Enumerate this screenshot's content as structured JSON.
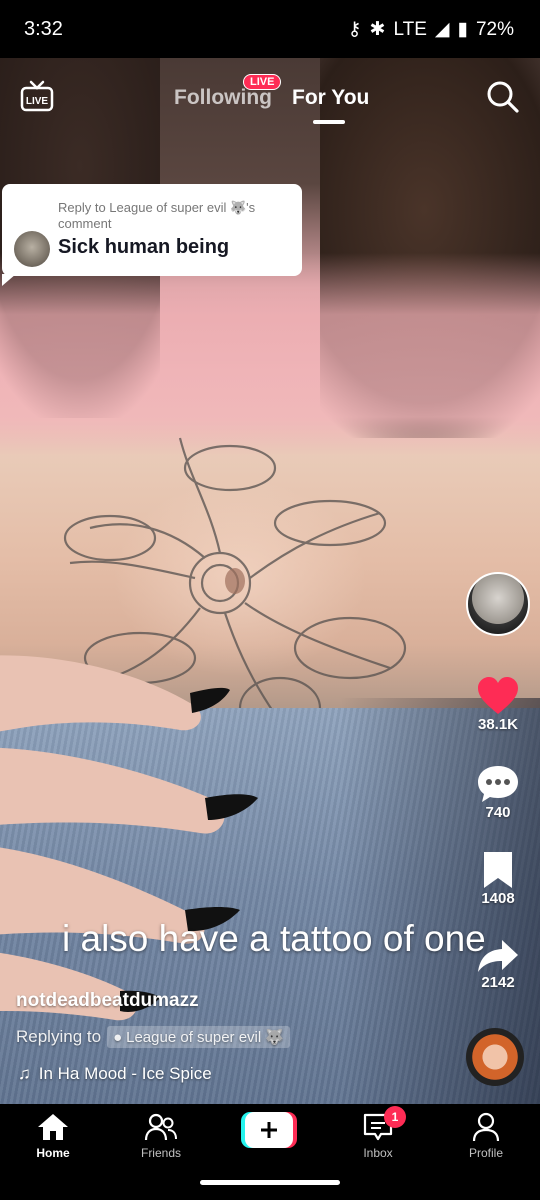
{
  "status_bar": {
    "time": "3:32",
    "network": "LTE",
    "battery": "72%"
  },
  "top_nav": {
    "live_icon": "live-tv-icon",
    "tabs": [
      {
        "label": "Following",
        "active": false
      },
      {
        "label": "For You",
        "active": true
      }
    ],
    "live_badge": "LIVE",
    "search_icon": "search-icon"
  },
  "reply_card": {
    "meta": "Reply to League of super evil 🐺's comment",
    "text": "Sick human being"
  },
  "video": {
    "caption_overlay": "i also have a tattoo of one"
  },
  "actions": {
    "likes": "38.1K",
    "comments": "740",
    "bookmarks": "1408",
    "shares": "2142"
  },
  "post": {
    "username": "notdeadbeatdumazz",
    "replying_prefix": "Replying to",
    "replying_to": "League of super evil 🐺",
    "music": "In Ha Mood - Ice Spice"
  },
  "bottom_nav": {
    "items": [
      {
        "label": "Home",
        "icon": "home-icon",
        "active": true
      },
      {
        "label": "Friends",
        "icon": "friends-icon",
        "active": false
      },
      {
        "label": "",
        "icon": "create-plus-icon",
        "active": false
      },
      {
        "label": "Inbox",
        "icon": "inbox-icon",
        "active": false
      },
      {
        "label": "Profile",
        "icon": "profile-icon",
        "active": false
      }
    ],
    "inbox_badge": "1"
  },
  "colors": {
    "accent": "#fe2c55",
    "cyan": "#25f4ee",
    "background": "#000000"
  }
}
